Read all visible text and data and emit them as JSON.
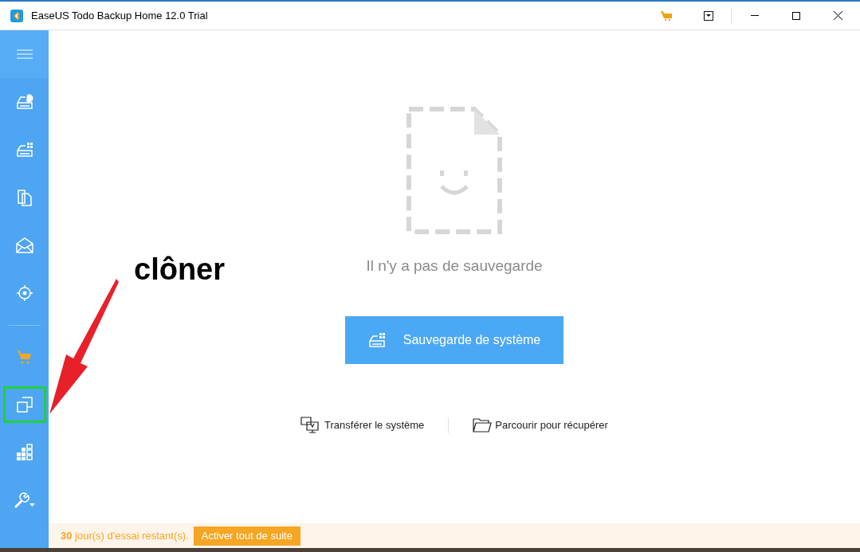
{
  "window": {
    "title": "EaseUS Todo Backup Home 12.0 Trial"
  },
  "sidebar": {
    "top_items": [
      {
        "kind": "disk-chart",
        "highlighted": false
      },
      {
        "kind": "disk-grid",
        "highlighted": false
      },
      {
        "kind": "files",
        "highlighted": false
      },
      {
        "kind": "mail",
        "highlighted": false
      },
      {
        "kind": "target",
        "highlighted": false
      }
    ],
    "bottom_items": [
      {
        "kind": "cart",
        "highlighted": false
      },
      {
        "kind": "clone",
        "highlighted": true
      },
      {
        "kind": "tiles",
        "highlighted": false
      },
      {
        "kind": "wrench",
        "highlighted": false
      }
    ]
  },
  "empty_state": {
    "message": "Il n'y a pas de sauvegarde"
  },
  "primary_button": {
    "label": "Sauvegarde de système"
  },
  "links": [
    {
      "kind": "transfer",
      "label": "Transférer le système"
    },
    {
      "kind": "folder",
      "label": "Parcourir pour récupérer"
    }
  ],
  "annotation": {
    "text": "clôner"
  },
  "trial_bar": {
    "message": "**30** jour(s) d'essai restant(s).",
    "button": "Activer tout de suite"
  }
}
